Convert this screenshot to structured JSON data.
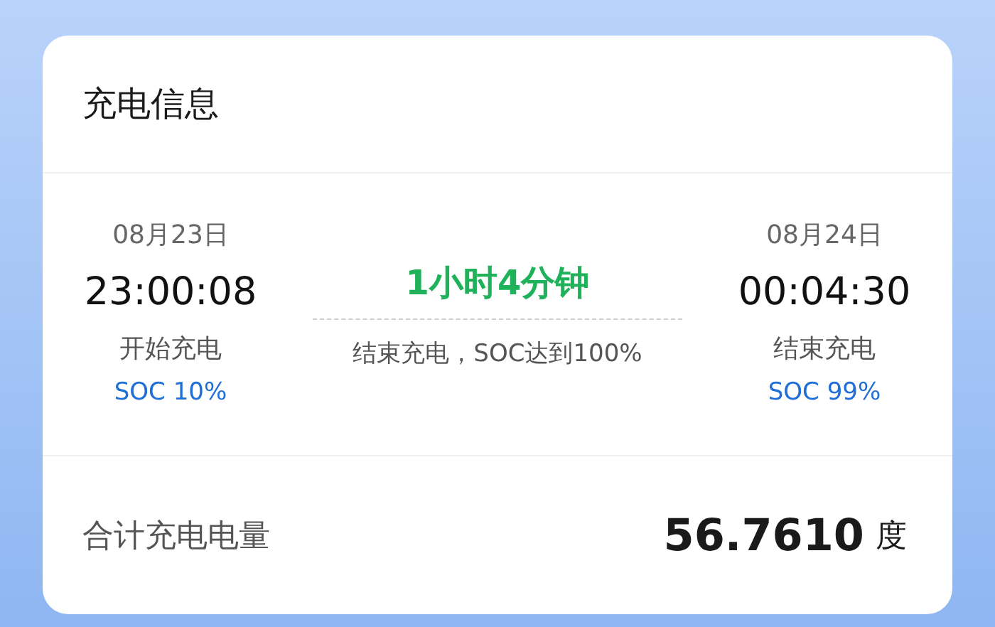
{
  "card": {
    "title": "充电信息",
    "start": {
      "date": "08月23日",
      "time": "23:00:08",
      "label": "开始充电",
      "soc": "SOC 10%"
    },
    "duration": {
      "value": "1小时4分钟",
      "reason": "结束充电，SOC达到100%"
    },
    "end": {
      "date": "08月24日",
      "time": "00:04:30",
      "label": "结束充电",
      "soc": "SOC 99%"
    },
    "total": {
      "label": "合计充电电量",
      "value": "56.7610",
      "unit": "度"
    }
  }
}
